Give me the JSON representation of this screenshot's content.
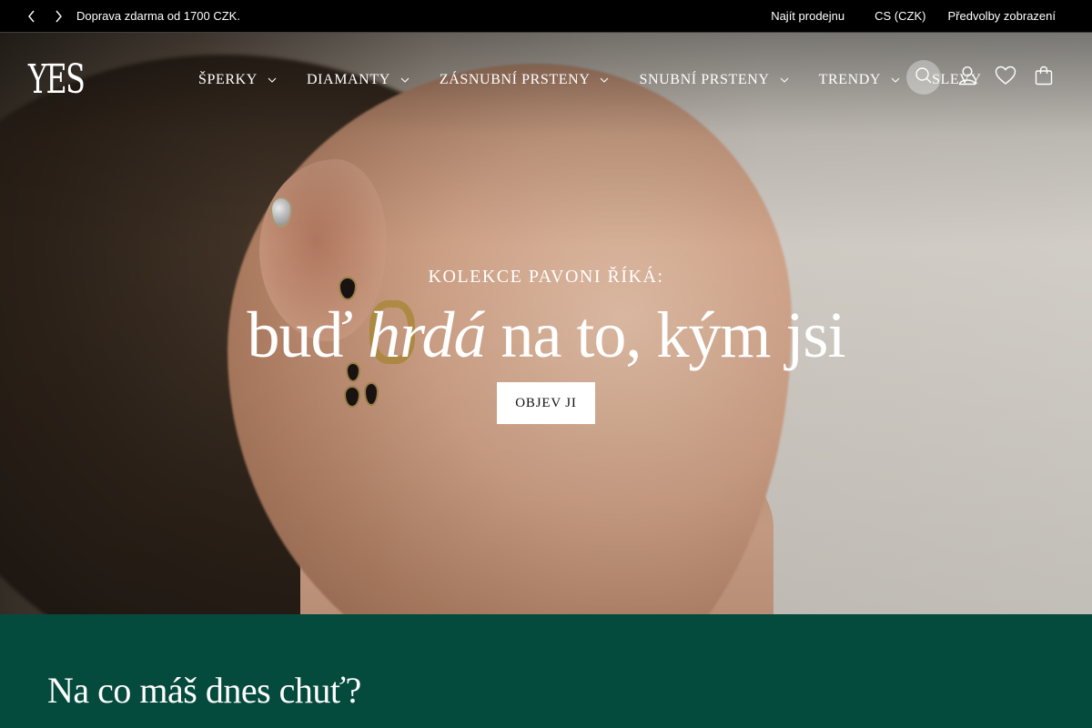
{
  "topbar": {
    "promo": "Doprava zdarma od 1700 CZK.",
    "store_link": "Najít prodejnu",
    "language": "CS (CZK)",
    "preferences": "Předvolby zobrazení"
  },
  "header": {
    "logo": "YES",
    "nav": [
      {
        "label": "ŠPERKY",
        "has_dropdown": true
      },
      {
        "label": "DIAMANTY",
        "has_dropdown": true
      },
      {
        "label": "ZÁSNUBNÍ PRSTENY",
        "has_dropdown": true
      },
      {
        "label": "SNUBNÍ PRSTENY",
        "has_dropdown": true
      },
      {
        "label": "TRENDY",
        "has_dropdown": true
      },
      {
        "label": "SLEVY",
        "has_dropdown": false
      }
    ],
    "icons": [
      "search-icon",
      "account-icon",
      "heart-icon",
      "bag-icon"
    ]
  },
  "hero": {
    "eyebrow": "KOLEKCE PAVONI ŘÍKÁ:",
    "headline_part1": "buď ",
    "headline_italic": "hrdá",
    "headline_part2": " na to, kým jsi",
    "cta": "OBJEV JI"
  },
  "section": {
    "title": "Na co máš dnes chuť?",
    "background": "#044a3d"
  }
}
